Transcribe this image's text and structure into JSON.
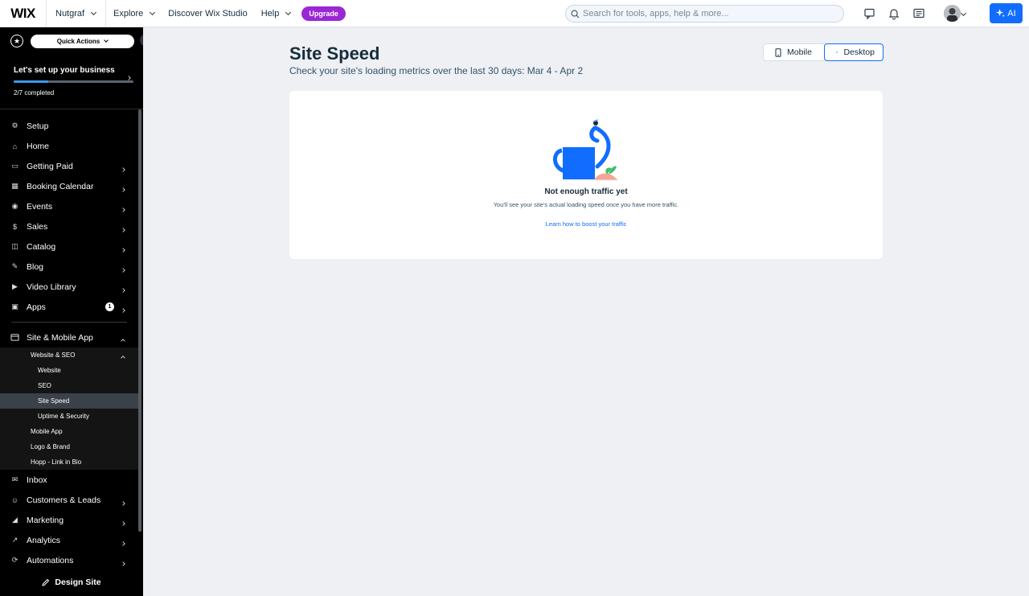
{
  "topbar": {
    "logo": "WIX",
    "site_name": "Nutgraf",
    "nav": [
      "Explore",
      "Discover Wix Studio",
      "Help"
    ],
    "upgrade_label": "Upgrade",
    "search_placeholder": "Search for tools, apps, help & more...",
    "ai_label": "AI",
    "icons": [
      "chat-icon",
      "bell-icon",
      "news-icon"
    ]
  },
  "sidebar": {
    "quick_actions_label": "Quick Actions",
    "setup": {
      "title": "Let's set up your business",
      "count": "2/7 completed",
      "progress": 0.29
    },
    "items": [
      {
        "label": "Setup",
        "icon": "wrench-icon",
        "chevron": false
      },
      {
        "label": "Home",
        "icon": "home-icon",
        "chevron": false
      },
      {
        "label": "Getting Paid",
        "icon": "payment-icon",
        "chevron": true
      },
      {
        "label": "Booking Calendar",
        "icon": "calendar-icon",
        "chevron": true
      },
      {
        "label": "Events",
        "icon": "events-icon",
        "chevron": true
      },
      {
        "label": "Sales",
        "icon": "dollar-icon",
        "chevron": true
      },
      {
        "label": "Catalog",
        "icon": "catalog-icon",
        "chevron": true
      },
      {
        "label": "Blog",
        "icon": "blog-icon",
        "chevron": true
      },
      {
        "label": "Video Library",
        "icon": "video-icon",
        "chevron": true
      },
      {
        "label": "Apps",
        "icon": "apps-icon",
        "chevron": true,
        "badge": "1"
      }
    ],
    "site_group": {
      "label": "Site & Mobile App",
      "sub_label": "Website & SEO",
      "sub_items": [
        "Website",
        "SEO",
        "Site Speed",
        "Uptime & Security"
      ],
      "active": "Site Speed",
      "other_items": [
        "Mobile App",
        "Logo & Brand",
        "Hopp - Link in Bio"
      ]
    },
    "bottom_items": [
      {
        "label": "Inbox",
        "icon": "inbox-icon",
        "chevron": false
      },
      {
        "label": "Customers & Leads",
        "icon": "customers-icon",
        "chevron": true
      },
      {
        "label": "Marketing",
        "icon": "marketing-icon",
        "chevron": true
      },
      {
        "label": "Analytics",
        "icon": "analytics-icon",
        "chevron": true
      },
      {
        "label": "Automations",
        "icon": "automations-icon",
        "chevron": true
      }
    ],
    "design_site_label": "Design Site"
  },
  "main": {
    "title": "Site Speed",
    "subtitle": "Check your site's loading metrics over the last 30 days: Mar 4 - Apr 2",
    "toggle": {
      "mobile": "Mobile",
      "desktop": "Desktop",
      "selected": "Desktop"
    },
    "empty": {
      "title": "Not enough traffic yet",
      "description": "You'll see your site's actual loading speed once you have more traffic.",
      "link": "Learn how to boost your traffic"
    }
  },
  "colors": {
    "accent": "#116dff",
    "upgrade": "#9a27d5",
    "sidebar_bg": "#000000",
    "page_bg": "#eef0f4"
  }
}
